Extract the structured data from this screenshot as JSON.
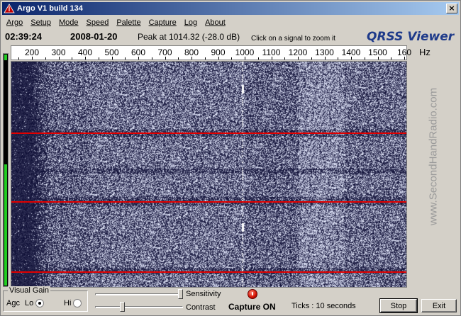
{
  "window": {
    "title": "Argo V1 build 134"
  },
  "menu": [
    "Argo",
    "Setup",
    "Mode",
    "Speed",
    "Palette",
    "Capture",
    "Log",
    "About"
  ],
  "info": {
    "time": "02:39:24",
    "date": "2008-01-20",
    "peak": "Peak at 1014.32 (-28.0 dB)",
    "hint": "Click on a signal to zoom it",
    "brand": "QRSS Viewer"
  },
  "scale": {
    "labels": [
      "200",
      "300",
      "400",
      "500",
      "600",
      "700",
      "800",
      "900",
      "1000",
      "1100",
      "1200",
      "1300",
      "1400",
      "1500",
      "160"
    ],
    "unit": "Hz"
  },
  "watermark": "www.SecondHandRadio.com",
  "controls": {
    "visual_gain_label": "Visual Gain",
    "agc_label": "Agc",
    "lo_label": "Lo",
    "hi_label": "Hi",
    "selected_gain": "Lo",
    "sensitivity_label": "Sensitivity",
    "sensitivity_level": 1.0,
    "contrast_label": "Contrast",
    "contrast_level": 0.3,
    "capture_status": "Capture ON",
    "ticks": "Ticks  : 10 seconds",
    "stop_label": "Stop",
    "exit_label": "Exit"
  },
  "level_meter": {
    "level": 0.52
  },
  "colors": {
    "waterfall_bg": "#05052a",
    "marker": "#e00000",
    "brand": "#1e3a8a",
    "title_bar": "#0a246a"
  }
}
